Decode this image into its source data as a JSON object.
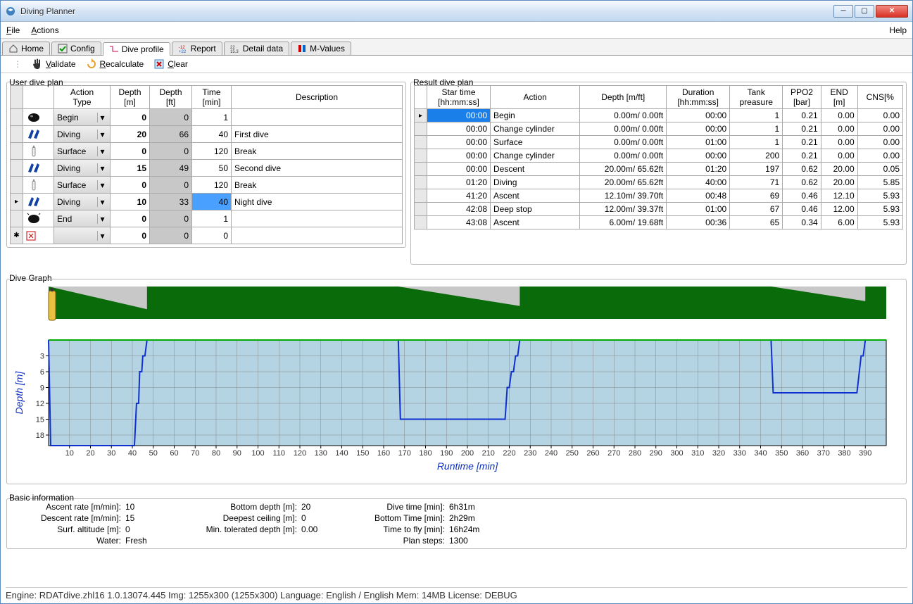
{
  "window": {
    "title": "Diving Planner"
  },
  "menu": {
    "file": "File",
    "actions": "Actions",
    "help": "Help"
  },
  "tabs": [
    {
      "label": "Home"
    },
    {
      "label": "Config"
    },
    {
      "label": "Dive profile"
    },
    {
      "label": "Report"
    },
    {
      "label": "Detail data"
    },
    {
      "label": "M-Values"
    }
  ],
  "toolbar": {
    "validate": "Validate",
    "recalc": "Recalculate",
    "clear": "Clear"
  },
  "userplan": {
    "title": "User dive plan",
    "headers": {
      "action": "Action\nType",
      "depthm": "Depth\n[m]",
      "depthft": "Depth\n[ft]",
      "time": "Time\n[min]",
      "desc": "Description"
    },
    "rows": [
      {
        "icon": "begin",
        "action": "Begin",
        "dm": "0",
        "dft": "0",
        "time": "1",
        "desc": ""
      },
      {
        "icon": "fins",
        "action": "Diving",
        "dm": "20",
        "dft": "66",
        "time": "40",
        "desc": "First dive"
      },
      {
        "icon": "tank",
        "action": "Surface",
        "dm": "0",
        "dft": "0",
        "time": "120",
        "desc": "Break"
      },
      {
        "icon": "fins",
        "action": "Diving",
        "dm": "15",
        "dft": "49",
        "time": "50",
        "desc": "Second dive"
      },
      {
        "icon": "tank",
        "action": "Surface",
        "dm": "0",
        "dft": "0",
        "time": "120",
        "desc": "Break"
      },
      {
        "icon": "fins",
        "action": "Diving",
        "dm": "10",
        "dft": "33",
        "time": "40",
        "desc": "Night dive"
      },
      {
        "icon": "end",
        "action": "End",
        "dm": "0",
        "dft": "0",
        "time": "1",
        "desc": ""
      },
      {
        "icon": "new",
        "action": "",
        "dm": "0",
        "dft": "0",
        "time": "0",
        "desc": ""
      }
    ],
    "selectedRow": 5
  },
  "resultplan": {
    "title": "Result dive plan",
    "headers": {
      "start": "Star time\n[hh:mm:ss]",
      "action": "Action",
      "depth": "Depth [m/ft]",
      "dur": "Duration\n[hh:mm:ss]",
      "tank": "Tank\npreasure",
      "ppo2": "PPO2\n[bar]",
      "end": "END\n[m]",
      "cns": "CNS[%"
    },
    "rows": [
      {
        "start": "00:00",
        "action": "Begin",
        "depth": "0.00m/  0.00ft",
        "dur": "00:00",
        "tank": "1",
        "ppo2": "0.21",
        "end": "0.00",
        "cns": "0.00",
        "sel": true
      },
      {
        "start": "00:00",
        "action": "Change cylinder",
        "depth": "0.00m/  0.00ft",
        "dur": "00:00",
        "tank": "1",
        "ppo2": "0.21",
        "end": "0.00",
        "cns": "0.00"
      },
      {
        "start": "00:00",
        "action": "Surface",
        "depth": "0.00m/  0.00ft",
        "dur": "01:00",
        "tank": "1",
        "ppo2": "0.21",
        "end": "0.00",
        "cns": "0.00"
      },
      {
        "start": "00:00",
        "action": "Change cylinder",
        "depth": "0.00m/  0.00ft",
        "dur": "00:00",
        "tank": "200",
        "ppo2": "0.21",
        "end": "0.00",
        "cns": "0.00"
      },
      {
        "start": "00:00",
        "action": "Descent",
        "depth": "20.00m/ 65.62ft",
        "dur": "01:20",
        "tank": "197",
        "ppo2": "0.62",
        "end": "20.00",
        "cns": "0.05"
      },
      {
        "start": "01:20",
        "action": "Diving",
        "depth": "20.00m/ 65.62ft",
        "dur": "40:00",
        "tank": "71",
        "ppo2": "0.62",
        "end": "20.00",
        "cns": "5.85"
      },
      {
        "start": "41:20",
        "action": "Ascent",
        "depth": "12.10m/ 39.70ft",
        "dur": "00:48",
        "tank": "69",
        "ppo2": "0.46",
        "end": "12.10",
        "cns": "5.93"
      },
      {
        "start": "42:08",
        "action": "Deep stop",
        "depth": "12.00m/ 39.37ft",
        "dur": "01:00",
        "tank": "67",
        "ppo2": "0.46",
        "end": "12.00",
        "cns": "5.93"
      },
      {
        "start": "43:08",
        "action": "Ascent",
        "depth": "6.00m/ 19.68ft",
        "dur": "00:36",
        "tank": "65",
        "ppo2": "0.34",
        "end": "6.00",
        "cns": "5.93"
      }
    ]
  },
  "chart": {
    "title": "Dive Graph"
  },
  "chart_data": {
    "type": "line",
    "title": "Dive Graph",
    "xlabel": "Runtime [min]",
    "ylabel": "Depth [m]",
    "xlim": [
      0,
      400
    ],
    "ylim": [
      0,
      20
    ],
    "xticks": [
      10,
      20,
      30,
      40,
      50,
      60,
      70,
      80,
      90,
      100,
      110,
      120,
      130,
      140,
      150,
      160,
      170,
      180,
      190,
      200,
      210,
      220,
      230,
      240,
      250,
      260,
      270,
      280,
      290,
      300,
      310,
      320,
      330,
      340,
      350,
      360,
      370,
      380,
      390
    ],
    "yticks": [
      3,
      6,
      9,
      12,
      15,
      18
    ],
    "profile": [
      {
        "t": 0,
        "d": 0
      },
      {
        "t": 1,
        "d": 20
      },
      {
        "t": 41,
        "d": 20
      },
      {
        "t": 42,
        "d": 12
      },
      {
        "t": 43,
        "d": 12
      },
      {
        "t": 43.5,
        "d": 6
      },
      {
        "t": 44.5,
        "d": 6
      },
      {
        "t": 45,
        "d": 3
      },
      {
        "t": 46,
        "d": 3
      },
      {
        "t": 47,
        "d": 0
      },
      {
        "t": 167,
        "d": 0
      },
      {
        "t": 168,
        "d": 15
      },
      {
        "t": 218,
        "d": 15
      },
      {
        "t": 219,
        "d": 9
      },
      {
        "t": 220,
        "d": 9
      },
      {
        "t": 221,
        "d": 6
      },
      {
        "t": 222,
        "d": 6
      },
      {
        "t": 223,
        "d": 3
      },
      {
        "t": 224,
        "d": 3
      },
      {
        "t": 225,
        "d": 0
      },
      {
        "t": 345,
        "d": 0
      },
      {
        "t": 346,
        "d": 10
      },
      {
        "t": 386,
        "d": 10
      },
      {
        "t": 388,
        "d": 3
      },
      {
        "t": 389,
        "d": 3
      },
      {
        "t": 390,
        "d": 0
      }
    ],
    "tank_segments": [
      {
        "start": 0,
        "end": 47,
        "start_pct": 100,
        "end_pct": 30
      },
      {
        "start": 167,
        "end": 225,
        "start_pct": 100,
        "end_pct": 40
      },
      {
        "start": 345,
        "end": 390,
        "start_pct": 100,
        "end_pct": 55
      }
    ]
  },
  "basic": {
    "title": "Basic information",
    "ascent_lbl": "Ascent rate [m/min]:",
    "ascent": "10",
    "descent_lbl": "Descent rate [m/min]:",
    "descent": "15",
    "alt_lbl": "Surf. altitude [m]:",
    "alt": "0",
    "water_lbl": "Water:",
    "water": "Fresh",
    "bottom_lbl": "Bottom depth [m]:",
    "bottom": "20",
    "ceiling_lbl": "Deepest ceiling [m]:",
    "ceiling": "0",
    "mintol_lbl": "Min. tolerated depth [m]:",
    "mintol": "0.00",
    "divetime_lbl": "Dive time [min]:",
    "divetime": "6h31m",
    "bottomtime_lbl": "Bottom Time [min]:",
    "bottomtime": "2h29m",
    "ttf_lbl": "Time to fly [min]:",
    "ttf": "16h24m",
    "steps_lbl": "Plan steps:",
    "steps": "1300"
  },
  "status": "Engine: RDATdive.zhl16 1.0.13074.445  Img: 1255x300 (1255x300)  Language: English / English  Mem: 14MB  License: DEBUG"
}
